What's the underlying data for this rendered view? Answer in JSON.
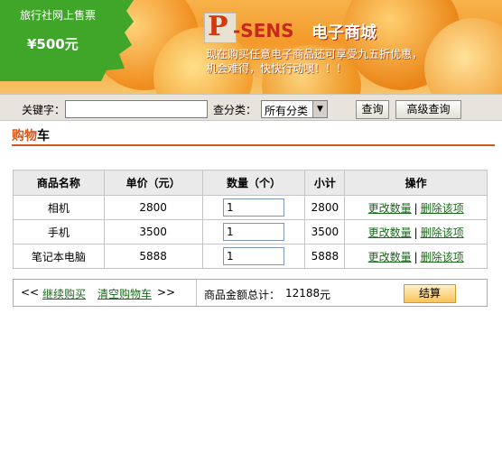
{
  "banner": {
    "seal_top": "旅行社网上售票",
    "seal_line1": "旅行社网上售票",
    "seal_price": "¥500元",
    "logo_p": "P",
    "logo_sens": "-SENS",
    "logo_cn": "电子商城",
    "promo": "现在购买任意电子商品还可享受九五折优惠，机会难得，快快行动噢！！！"
  },
  "search": {
    "keyword_label": "关键字：",
    "keyword_value": "",
    "category_label": "查分类：",
    "category_value": "所有分类",
    "query_button": "查询",
    "advanced_button": "高级查询"
  },
  "section": {
    "title_highlight": "购物",
    "title_rest": "车"
  },
  "table": {
    "headers": [
      "商品名称",
      "单价（元）",
      "数量（个）",
      "小计",
      "操作"
    ],
    "rows": [
      {
        "name": "相机",
        "price": "2800",
        "qty": "1",
        "subtotal": "2800",
        "edit": "更改数量",
        "sep": "|",
        "delete": "删除该项"
      },
      {
        "name": "手机",
        "price": "3500",
        "qty": "1",
        "subtotal": "3500",
        "edit": "更改数量",
        "sep": "|",
        "delete": "删除该项"
      },
      {
        "name": "笔记本电脑",
        "price": "5888",
        "qty": "1",
        "subtotal": "5888",
        "edit": "更改数量",
        "sep": "|",
        "delete": "删除该项"
      }
    ]
  },
  "footer": {
    "left_arrows": "<<",
    "continue_link": "继续购买",
    "clear_link": "清空购物车",
    "right_arrows": ">>",
    "total_label": "商品金额总计：",
    "total_value": "12188",
    "total_unit": "元",
    "checkout_button": "结算"
  },
  "colors": {
    "link": "#196a1a",
    "accent": "#d4571a",
    "banner": "#f39a2a"
  }
}
